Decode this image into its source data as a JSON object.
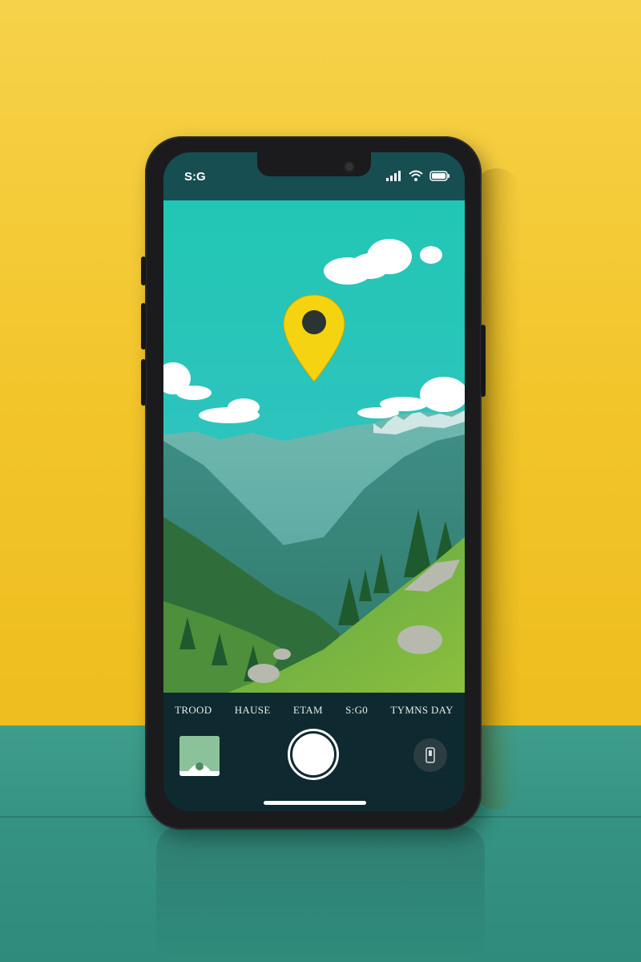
{
  "status_bar": {
    "time": "S:G",
    "icons": [
      "cellular-signal-icon",
      "wifi-icon",
      "battery-icon"
    ]
  },
  "viewfinder": {
    "pin_icon": "location-pin-icon",
    "scene": "mountain-valley-landscape"
  },
  "camera_modes": [
    {
      "label": "TROOD"
    },
    {
      "label": "HAUSE"
    },
    {
      "label": "ETAM"
    },
    {
      "label": "S:G0"
    },
    {
      "label": "TYMNS DAY"
    }
  ],
  "controls": {
    "gallery_icon": "gallery-thumbnail",
    "shutter_icon": "shutter-button",
    "switch_icon": "camera-switch-icon"
  },
  "colors": {
    "wall": "#f2c52a",
    "floor": "#359383",
    "sky": "#24cbb8",
    "pin": "#f5d311",
    "controls_bg": "#0e2a30"
  }
}
